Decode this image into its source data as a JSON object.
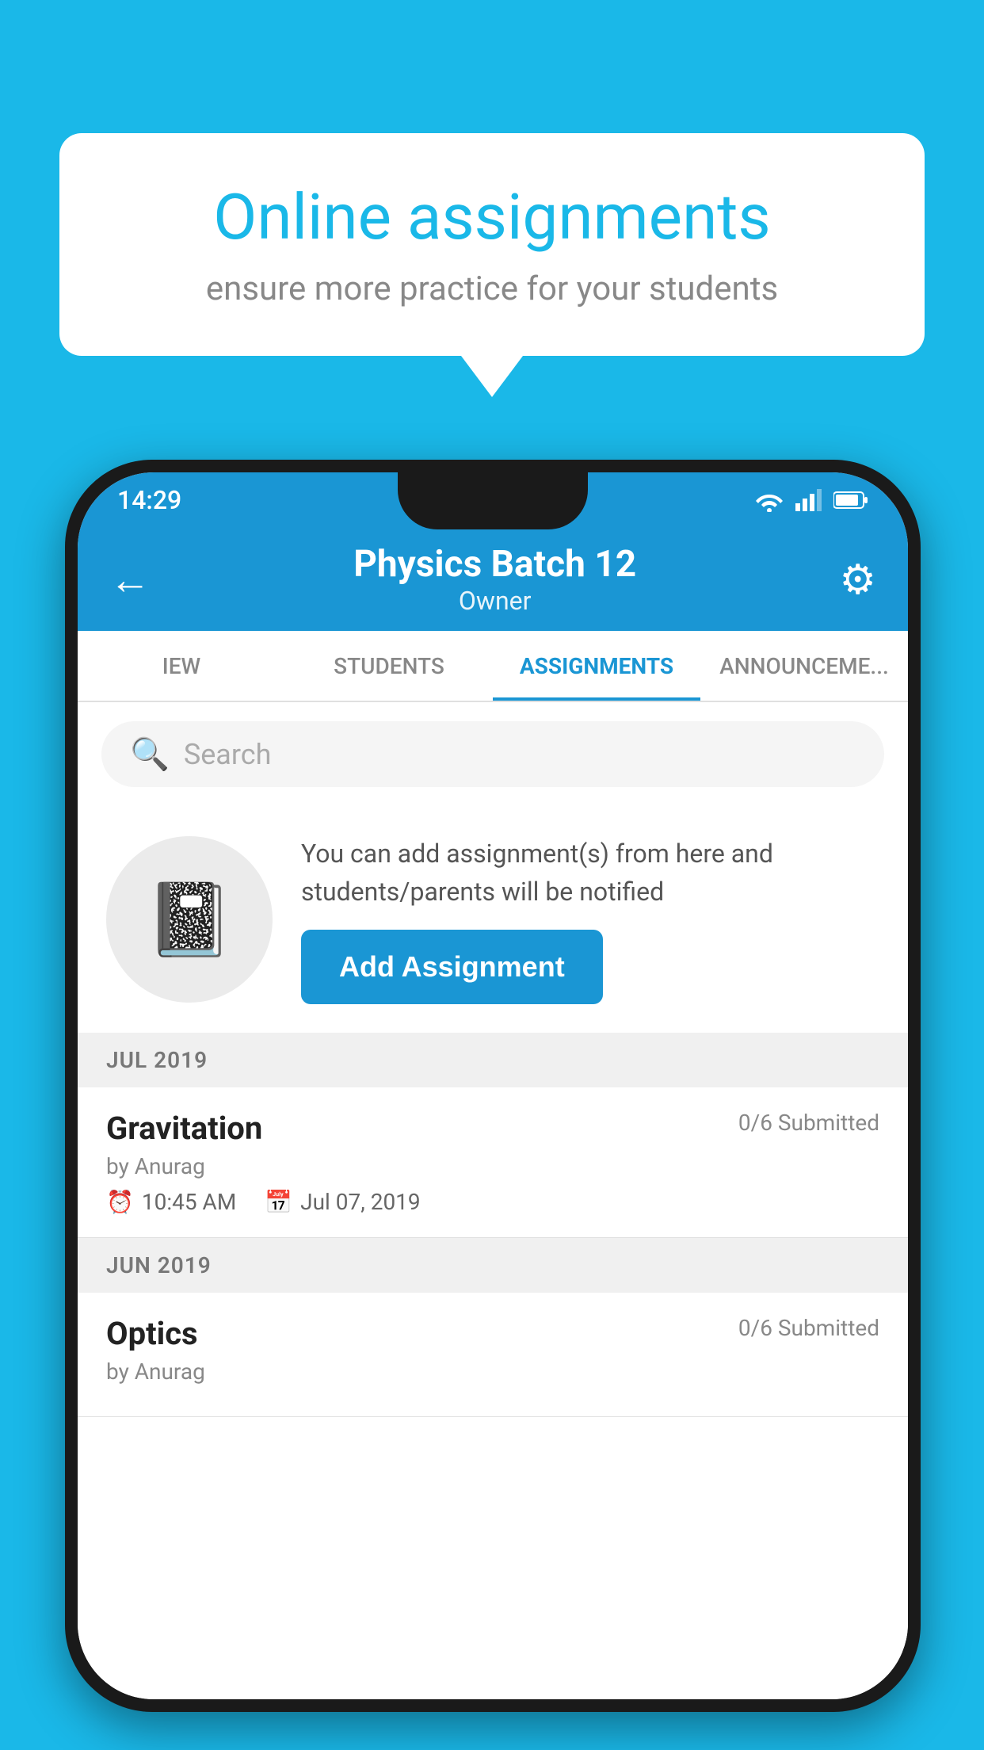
{
  "background_color": "#1ab8e8",
  "speech_bubble": {
    "title": "Online assignments",
    "subtitle": "ensure more practice for your students"
  },
  "phone": {
    "status_bar": {
      "time": "14:29"
    },
    "app_bar": {
      "title": "Physics Batch 12",
      "subtitle": "Owner",
      "back_label": "←",
      "settings_label": "⚙"
    },
    "tabs": [
      {
        "label": "IEW",
        "active": false
      },
      {
        "label": "STUDENTS",
        "active": false
      },
      {
        "label": "ASSIGNMENTS",
        "active": true
      },
      {
        "label": "ANNOUNCEM...",
        "active": false
      }
    ],
    "search": {
      "placeholder": "Search"
    },
    "promo": {
      "description": "You can add assignment(s) from here and students/parents will be notified",
      "button_label": "Add Assignment"
    },
    "sections": [
      {
        "title": "JUL 2019",
        "assignments": [
          {
            "name": "Gravitation",
            "submitted": "0/6 Submitted",
            "by": "by Anurag",
            "time": "10:45 AM",
            "date": "Jul 07, 2019"
          }
        ]
      },
      {
        "title": "JUN 2019",
        "assignments": [
          {
            "name": "Optics",
            "submitted": "0/6 Submitted",
            "by": "by Anurag",
            "time": "",
            "date": ""
          }
        ]
      }
    ]
  }
}
